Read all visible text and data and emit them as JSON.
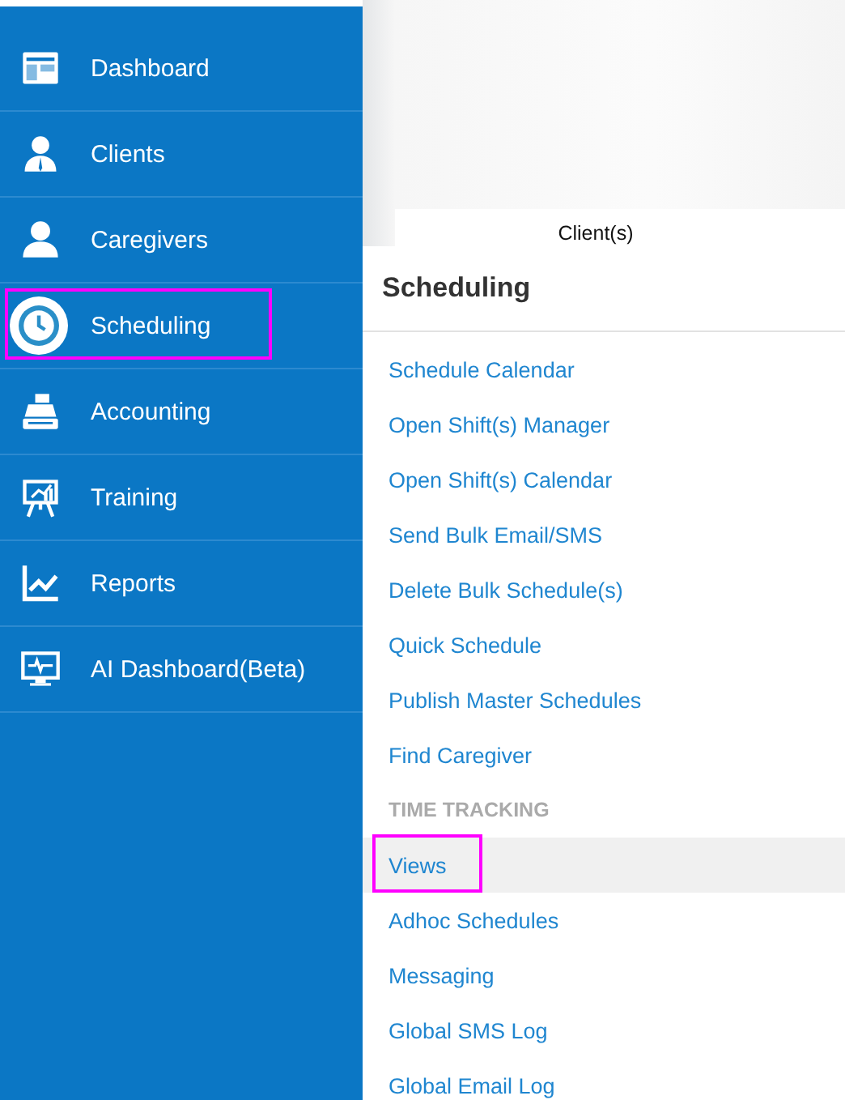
{
  "sidebar": {
    "items": [
      {
        "label": "Dashboard",
        "selected": false
      },
      {
        "label": "Clients",
        "selected": false
      },
      {
        "label": "Caregivers",
        "selected": false
      },
      {
        "label": "Scheduling",
        "selected": true
      },
      {
        "label": "Accounting",
        "selected": false
      },
      {
        "label": "Training",
        "selected": false
      },
      {
        "label": "Reports",
        "selected": false
      },
      {
        "label": "AI Dashboard(Beta)",
        "selected": false
      }
    ]
  },
  "background": {
    "column_heading": "Client(s)"
  },
  "menu": {
    "title": "Scheduling",
    "sections": [
      {
        "items": [
          {
            "label": "Schedule Calendar",
            "selected": false
          },
          {
            "label": "Open Shift(s) Manager",
            "selected": false
          },
          {
            "label": "Open Shift(s) Calendar",
            "selected": false
          },
          {
            "label": "Send Bulk Email/SMS",
            "selected": false
          },
          {
            "label": "Delete Bulk Schedule(s)",
            "selected": false
          },
          {
            "label": "Quick Schedule",
            "selected": false
          },
          {
            "label": "Publish Master Schedules",
            "selected": false
          },
          {
            "label": "Find Caregiver",
            "selected": false
          }
        ]
      },
      {
        "heading": "TIME TRACKING",
        "items": [
          {
            "label": "Views",
            "selected": true
          },
          {
            "label": "Adhoc Schedules",
            "selected": false
          },
          {
            "label": "Messaging",
            "selected": false
          },
          {
            "label": "Global SMS Log",
            "selected": false
          },
          {
            "label": "Global Email Log",
            "selected": false
          }
        ]
      }
    ]
  }
}
